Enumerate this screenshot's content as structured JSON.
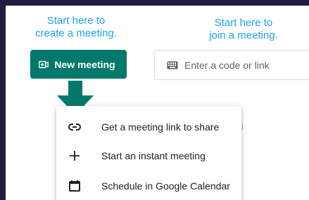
{
  "annotations": {
    "create_line1": "Start here to",
    "create_line2": "create a meeting.",
    "join_line1": "Start here to",
    "join_line2": "join a meeting."
  },
  "new_meeting_button": {
    "label": "New meeting",
    "icon": "video-call-icon",
    "color": "#00796b"
  },
  "code_input": {
    "placeholder": "Enter a code or link",
    "icon": "keyboard-icon"
  },
  "menu": {
    "items": [
      {
        "label": "Get a meeting link to share",
        "icon": "link-icon"
      },
      {
        "label": "Start an instant meeting",
        "icon": "plus-icon"
      },
      {
        "label": "Schedule in Google Calendar",
        "icon": "calendar-icon"
      }
    ]
  },
  "colors": {
    "annotation": "#1da1f2",
    "frame": "#241a3f",
    "arrow": "#00796b"
  }
}
